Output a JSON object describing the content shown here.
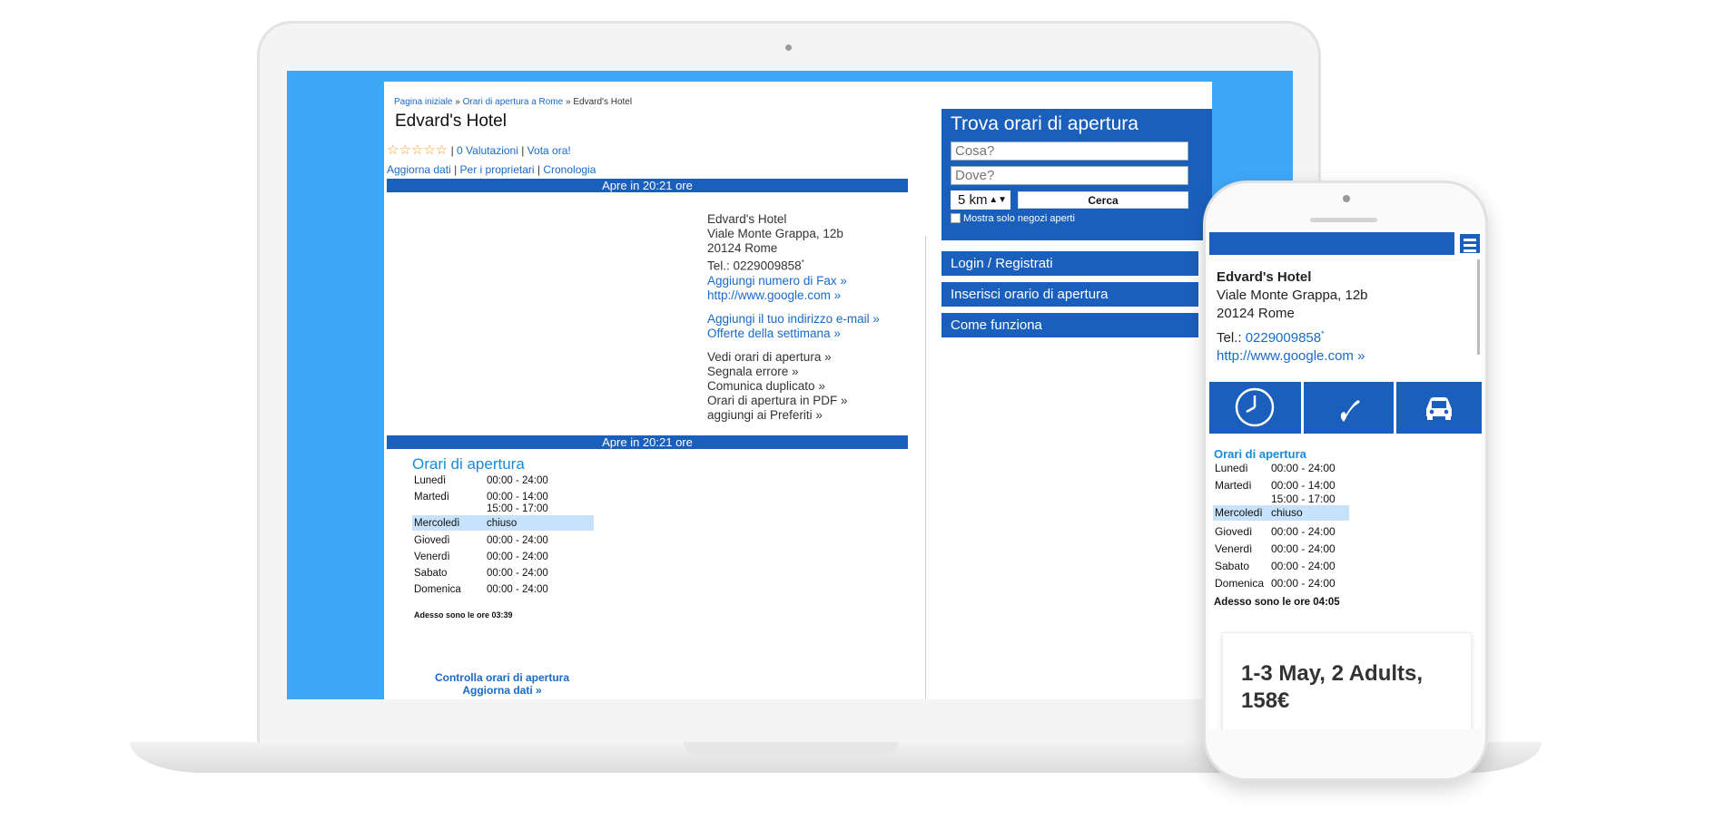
{
  "breadcrumb": {
    "home": "Pagina iniziale",
    "sep": "»",
    "category": "Orari di apertura a Rome",
    "current": "Edvard's Hotel"
  },
  "business": {
    "name": "Edvard's Hotel",
    "street": "Viale Monte Grappa, 12b",
    "city": "20124 Rome",
    "tel_label": "Tel.:",
    "tel": "0229009858",
    "tel_mark": "*",
    "website": "http://www.google.com »"
  },
  "rating": {
    "stars": "☆☆☆☆☆",
    "count_link": "0 Valutazioni",
    "vote_link": "Vota ora!"
  },
  "sublinks": {
    "update": "Aggiorna dati",
    "owners": "Per i proprietari",
    "history": "Cronologia"
  },
  "status_bar": "Apre in 20:21 ore",
  "info_links": {
    "add_fax": "Aggiungi numero di Fax »",
    "add_email": "Aggiungi il tuo indirizzo e-mail »",
    "offers": "Offerte della settimana »",
    "see_hours": "Vedi orari di apertura »",
    "report_error": "Segnala errore »",
    "report_duplicate": "Comunica duplicato »",
    "hours_pdf": "Orari di apertura in PDF »",
    "add_favorites": "aggiungi ai Preferiti »"
  },
  "hours": {
    "title": "Orari di apertura",
    "rows": [
      {
        "day": "Lunedì",
        "time": "00:00 - 24:00",
        "time2": ""
      },
      {
        "day": "Martedì",
        "time": "00:00 - 14:00",
        "time2": "15:00 - 17:00"
      },
      {
        "day": "Mercoledì",
        "time": "chiuso",
        "time2": ""
      },
      {
        "day": "Giovedì",
        "time": "00:00 - 24:00",
        "time2": ""
      },
      {
        "day": "Venerdì",
        "time": "00:00 - 24:00",
        "time2": ""
      },
      {
        "day": "Sabato",
        "time": "00:00 - 24:00",
        "time2": ""
      },
      {
        "day": "Domenica",
        "time": "00:00 - 24:00",
        "time2": ""
      }
    ],
    "now_laptop": "Adesso sono le ore 03:39",
    "now_phone": "Adesso sono le ore 04:05",
    "check_line1": "Controlla orari di apertura",
    "check_line2": "Aggiorna dati »"
  },
  "search": {
    "title": "Trova orari di apertura",
    "what_placeholder": "Cosa?",
    "where_placeholder": "Dove?",
    "radius": "5 km",
    "button": "Cerca",
    "only_open": "Mostra solo negozi aperti"
  },
  "side_menu": [
    "Login / Registrati",
    "Inserisci orario di apertura",
    "Come funziona"
  ],
  "phone_card": {
    "text": "1-3 May, 2 Adults, 158€"
  },
  "colors": {
    "primary": "#1b5fbd",
    "screen_bg": "#3fa7f7",
    "link": "#1a6ac8",
    "highlight": "#c7e3fb"
  }
}
